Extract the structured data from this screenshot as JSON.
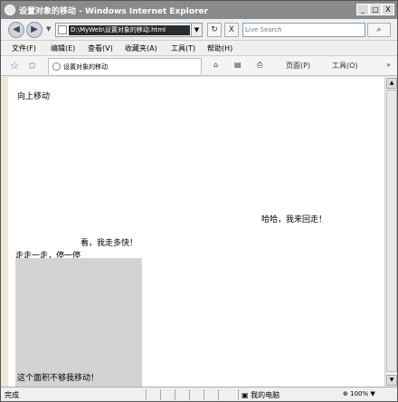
{
  "window": {
    "title": "设置对象的移动 - Windows Internet Explorer",
    "controls": {
      "minimize": "_",
      "maximize": "□",
      "close": "X"
    }
  },
  "addressbar": {
    "back": "◀",
    "forward": "▶",
    "url": "D:\\MyWeb\\设置对象的移动.html",
    "refresh": "↻",
    "stop": "X"
  },
  "search": {
    "placeholder": "Live Search",
    "go": "⌕"
  },
  "menu": [
    "文件(F)",
    "编辑(E)",
    "查看(V)",
    "收藏夹(A)",
    "工具(T)",
    "帮助(H)"
  ],
  "tab": {
    "title": "设置对象的移动"
  },
  "commands": {
    "home": "⌂",
    "feeds": "▤",
    "print": "⎙",
    "page": "页面(P)",
    "tools": "工具(O)",
    "more": "»"
  },
  "content": {
    "move_up": "向上移动",
    "haha": "哈哈，我来回走！",
    "look": "看，我走多快！",
    "walk_stop": "走走一走，停一停",
    "area_text": "这个面积不够我移动！"
  },
  "status": {
    "text": "完成",
    "zone": "我的电脑",
    "zoom": "100%"
  }
}
